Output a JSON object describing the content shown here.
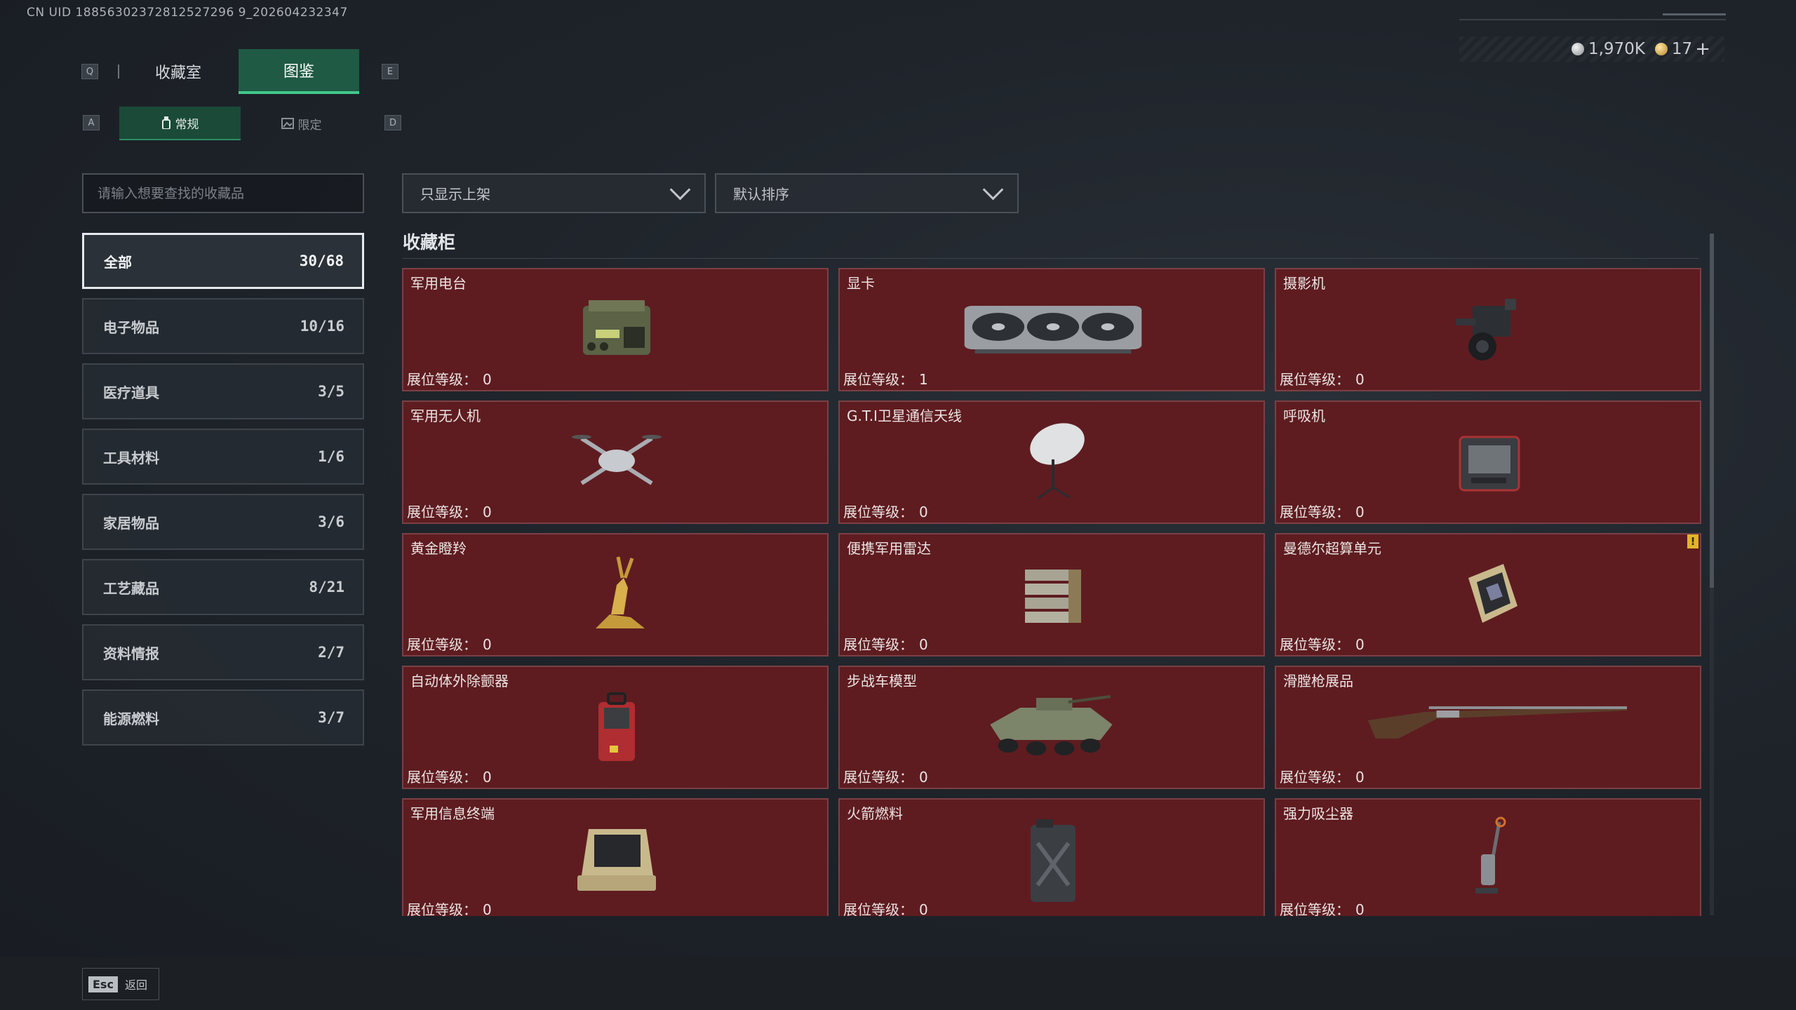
{
  "uid": "CN UID 18856302372812527296 9_202604232347",
  "currency": {
    "silver": "1,970K",
    "gold": "17",
    "add": "+"
  },
  "keys": {
    "prev_tab": "Q",
    "next_tab": "E",
    "prev_sub": "A",
    "next_sub": "D"
  },
  "tabs": [
    {
      "label": "收藏室"
    },
    {
      "label": "图鉴"
    }
  ],
  "subtabs": [
    {
      "label": "常规"
    },
    {
      "label": "限定"
    }
  ],
  "search": {
    "placeholder": "请输入想要查找的收藏品"
  },
  "filters": {
    "shelf": "只显示上架",
    "sort": "默认排序"
  },
  "section_title": "收藏柜",
  "categories": [
    {
      "label": "全部",
      "count": "30/68"
    },
    {
      "label": "电子物品",
      "count": "10/16"
    },
    {
      "label": "医疗道具",
      "count": "3/5"
    },
    {
      "label": "工具材料",
      "count": "1/6"
    },
    {
      "label": "家居物品",
      "count": "3/6"
    },
    {
      "label": "工艺藏品",
      "count": "8/21"
    },
    {
      "label": "资料情报",
      "count": "2/7"
    },
    {
      "label": "能源燃料",
      "count": "3/7"
    }
  ],
  "level_label": "展位等级：",
  "items": [
    {
      "name": "军用电台",
      "level": "0",
      "icon": "radio-icon"
    },
    {
      "name": "显卡",
      "level": "1",
      "icon": "gpu-icon"
    },
    {
      "name": "摄影机",
      "level": "0",
      "icon": "camera-icon"
    },
    {
      "name": "军用无人机",
      "level": "0",
      "icon": "drone-icon"
    },
    {
      "name": "G.T.I卫星通信天线",
      "level": "0",
      "icon": "satellite-dish-icon"
    },
    {
      "name": "呼吸机",
      "level": "0",
      "icon": "ventilator-icon"
    },
    {
      "name": "黄金瞪羚",
      "level": "0",
      "icon": "golden-gazelle-icon"
    },
    {
      "name": "便携军用雷达",
      "level": "0",
      "icon": "radar-icon"
    },
    {
      "name": "曼德尔超算单元",
      "level": "0",
      "icon": "compute-unit-icon",
      "warning": "!"
    },
    {
      "name": "自动体外除颤器",
      "level": "0",
      "icon": "defibrillator-icon"
    },
    {
      "name": "步战车模型",
      "level": "0",
      "icon": "ifv-model-icon"
    },
    {
      "name": "滑膛枪展品",
      "level": "0",
      "icon": "musket-icon"
    },
    {
      "name": "军用信息终端",
      "level": "0",
      "icon": "terminal-icon"
    },
    {
      "name": "火箭燃料",
      "level": "0",
      "icon": "fuel-can-icon"
    },
    {
      "name": "强力吸尘器",
      "level": "0",
      "icon": "vacuum-icon"
    }
  ],
  "footer": {
    "esc_key": "Esc",
    "esc_label": "返回"
  },
  "colors": {
    "accent": "#40c98c",
    "card_bg": "#5e1c20",
    "card_border": "#7a4045"
  }
}
